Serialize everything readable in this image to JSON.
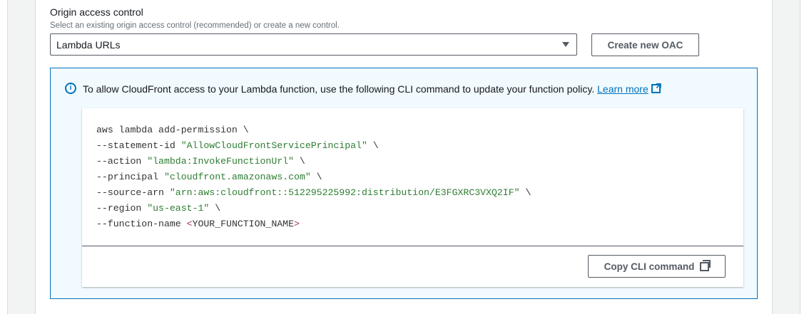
{
  "field": {
    "label": "Origin access control",
    "description": "Select an existing origin access control (recommended) or create a new control.",
    "selected": "Lambda URLs"
  },
  "create_button": "Create new OAC",
  "info": {
    "text": "To allow CloudFront access to your Lambda function, use the following CLI command to update your function policy.",
    "link": "Learn more"
  },
  "cli": {
    "l1": "aws lambda add-permission \\",
    "l2a": "--statement-id ",
    "l2b": "\"AllowCloudFrontServicePrincipal\"",
    "l2c": " \\",
    "l3a": "--action ",
    "l3b": "\"lambda:InvokeFunctionUrl\"",
    "l3c": " \\",
    "l4a": "--principal ",
    "l4b": "\"cloudfront.amazonaws.com\"",
    "l4c": " \\",
    "l5a": "--source-arn ",
    "l5b": "\"arn:aws:cloudfront::512295225992:distribution/E3FGXRC3VXQ2IF\"",
    "l5c": " \\",
    "l6a": "--region ",
    "l6b": "\"us-east-1\"",
    "l6c": " \\",
    "l7a": "--function-name ",
    "l7b": "<",
    "l7c": "YOUR_FUNCTION_NAME",
    "l7d": ">"
  },
  "copy_button": "Copy CLI command"
}
